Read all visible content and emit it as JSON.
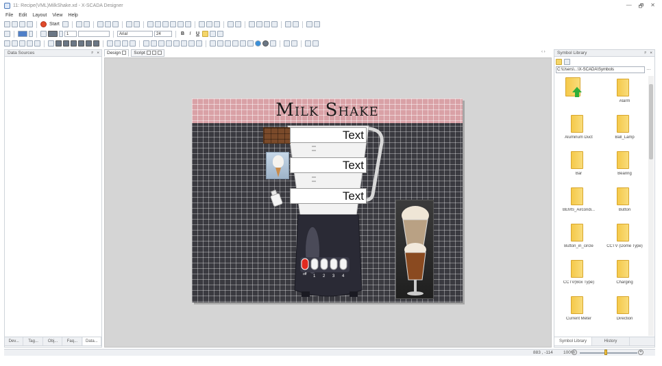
{
  "window": {
    "title": "11: Recipe(VML)MilkShake.xd - X-SCADA Designer",
    "controls": [
      "—",
      "🗗",
      "✕"
    ]
  },
  "menu": [
    "File",
    "Edit",
    "Layout",
    "View",
    "Help"
  ],
  "toolbar1": {
    "start_label": "Start"
  },
  "toolbar2": {
    "line_width": "1",
    "font_name": "Arial",
    "font_size": "24",
    "bold": "B",
    "italic": "I",
    "underline": "U"
  },
  "left_panel": {
    "title": "Data Sources",
    "tabs": [
      "Dev...",
      "Tag...",
      "Obj...",
      "Faq...",
      "Data..."
    ],
    "active_tab": 4
  },
  "doc_tabs": [
    "Design",
    "Script"
  ],
  "design": {
    "title": "Milk Shake",
    "text_boxes": [
      "Text",
      "Text",
      "Text"
    ],
    "dial_labels": [
      "off",
      "1",
      "2",
      "3",
      "4"
    ]
  },
  "symbol_library": {
    "title": "Symbol Library",
    "path": "C:\\Users\\...\\X-SCADA\\Symbols",
    "items": [
      "",
      "Alarm",
      "Aluminum Duct",
      "Ball_Lamp",
      "Bar",
      "Bearing",
      "BEMS_Aircondi...",
      "Button",
      "Button_in_circle",
      "CCTV (Dome Type)",
      "CCTV(Box Type)",
      "Charging",
      "Current Meter",
      "Direction"
    ],
    "tabs": [
      "Symbol Library",
      "History"
    ]
  },
  "status": {
    "coords": "883 , -114",
    "zoom": "100%",
    "zoom_level": 0.45
  },
  "colors": {
    "header_pink": "#d9a1a6",
    "canvas_dark": "#3a3a40",
    "folder": "#f5c94a"
  }
}
